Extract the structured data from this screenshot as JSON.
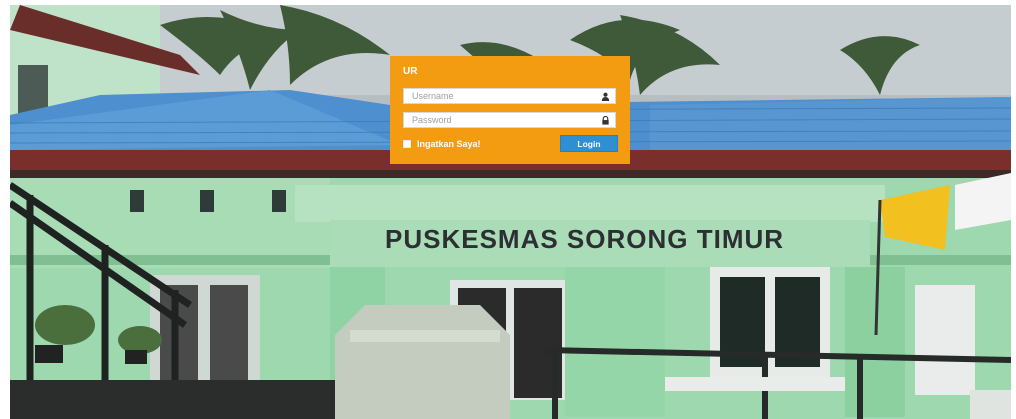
{
  "login": {
    "title": "UR",
    "username_placeholder": "Username",
    "password_placeholder": "Password",
    "remember_label": "Ingatkan Saya!",
    "login_button": "Login",
    "accent": "#f39c12",
    "button_color": "#2f8fd3"
  },
  "background": {
    "building_sign": "PUSKESMAS SORONG TIMUR"
  },
  "icons": {
    "username": "user-icon",
    "password": "lock-icon",
    "remember": "checkbox"
  }
}
